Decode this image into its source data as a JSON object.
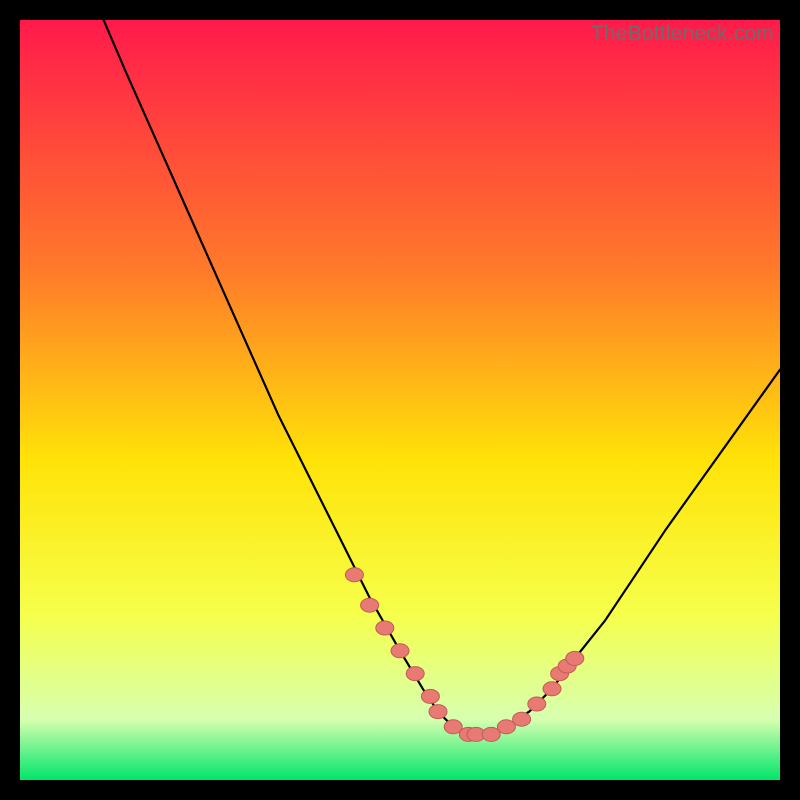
{
  "watermark": "TheBottleneck.com",
  "colors": {
    "gradient_top": "#ff1a4b",
    "gradient_mid1": "#ff7a2a",
    "gradient_mid2": "#ffe308",
    "gradient_mid3": "#f6ff4a",
    "gradient_bottom_pale": "#d7ffb0",
    "gradient_bottom": "#00e66a",
    "curve": "#000000",
    "marker_fill": "#e77b74",
    "marker_stroke": "#c55a56"
  },
  "chart_data": {
    "type": "line",
    "title": "",
    "xlabel": "",
    "ylabel": "",
    "xlim": [
      0,
      100
    ],
    "ylim": [
      0,
      100
    ],
    "inverted_y": false,
    "series": [
      {
        "name": "bottleneck-curve",
        "x": [
          11,
          14,
          18,
          22,
          26,
          30,
          34,
          38,
          42,
          46,
          50,
          53,
          55,
          57,
          59,
          61,
          64,
          67,
          70,
          73,
          77,
          81,
          85,
          90,
          95,
          100
        ],
        "y": [
          100,
          93,
          84,
          75,
          66,
          57,
          48,
          40,
          32,
          24,
          17,
          12,
          9,
          7,
          6,
          6,
          7,
          9,
          12,
          16,
          21,
          27,
          33,
          40,
          47,
          54
        ]
      }
    ],
    "markers": {
      "name": "highlight-dots",
      "x": [
        44,
        46,
        48,
        50,
        52,
        54,
        55,
        57,
        59,
        60,
        62,
        64,
        66,
        68,
        70,
        71,
        72,
        73
      ],
      "y": [
        27,
        23,
        20,
        17,
        14,
        11,
        9,
        7,
        6,
        6,
        6,
        7,
        8,
        10,
        12,
        14,
        15,
        16
      ]
    }
  }
}
